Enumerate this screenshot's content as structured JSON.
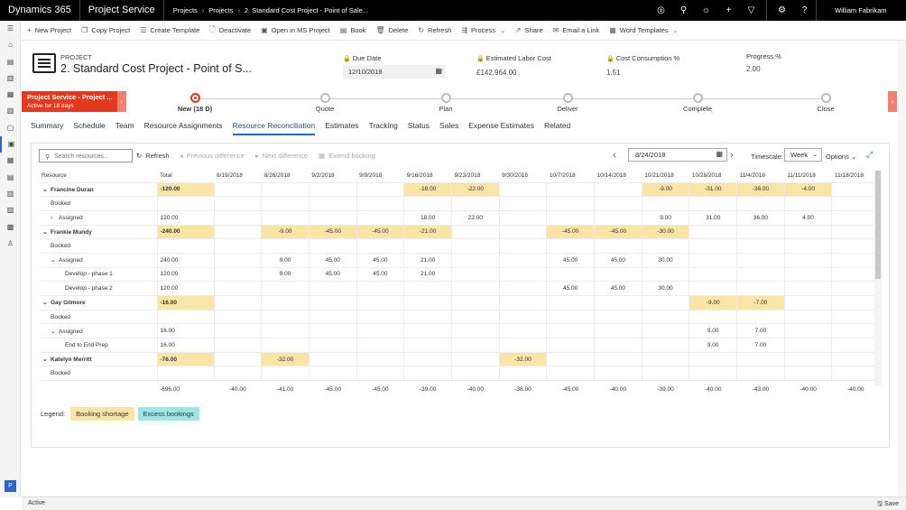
{
  "topbar": {
    "brand": "Dynamics 365",
    "app": "Project Service",
    "crumbs": [
      "Projects",
      "Projects",
      "2. Standard Cost Project - Point of Sale..."
    ],
    "user": "William Fabrikam",
    "icons": [
      "target-icon",
      "search-icon",
      "lightbulb-icon",
      "plus-icon",
      "filter-icon",
      "gear-icon",
      "help-icon"
    ]
  },
  "leftnav": {
    "items": [
      "menu-icon",
      "home-icon",
      "recent-icon",
      "pinned-icon",
      "projects-icon",
      "resources-icon",
      "documents-icon",
      "project-grid-icon",
      "calendar-icon",
      "schedule-icon",
      "list-icon",
      "contacts-icon",
      "settings-icon",
      "people-icon"
    ],
    "badge": "P"
  },
  "commands": [
    {
      "icon": "+",
      "label": "New Project",
      "chevron": false
    },
    {
      "icon": "❐",
      "label": "Copy Project",
      "chevron": false
    },
    {
      "icon": "☰",
      "label": "Create Template",
      "chevron": false
    },
    {
      "icon": "🗋",
      "label": "Deactivate",
      "chevron": false
    },
    {
      "icon": "▣",
      "label": "Open in MS Project",
      "chevron": false
    },
    {
      "icon": "▤",
      "label": "Book",
      "chevron": false
    },
    {
      "icon": "🗑",
      "label": "Delete",
      "chevron": false
    },
    {
      "icon": "↻",
      "label": "Refresh",
      "chevron": false
    },
    {
      "icon": "⇶",
      "label": "Process",
      "chevron": true
    },
    {
      "icon": "↗",
      "label": "Share",
      "chevron": false
    },
    {
      "icon": "✉",
      "label": "Email a Link",
      "chevron": false
    },
    {
      "icon": "▦",
      "label": "Word Templates",
      "chevron": true
    }
  ],
  "header": {
    "type": "PROJECT",
    "name": "2. Standard Cost Project - Point of S...",
    "due_date_label": "Due Date",
    "due_date": "12/10/2018",
    "labor_label": "Estimated Labor Cost",
    "labor": "£142,964.00",
    "cc_label": "Cost Consumption %",
    "cc": "1.51",
    "progress_label": "Progress %",
    "progress": "2.00"
  },
  "bpf": {
    "active_title": "Project Service - Project ...",
    "active_sub": "Active for 18 days",
    "stages": [
      {
        "label": "New  (18 D)",
        "current": true
      },
      {
        "label": "Quote",
        "current": false
      },
      {
        "label": "Plan",
        "current": false
      },
      {
        "label": "Deliver",
        "current": false
      },
      {
        "label": "Complete",
        "current": false
      },
      {
        "label": "Close",
        "current": false
      }
    ]
  },
  "tabs": [
    {
      "label": "Summary",
      "active": false
    },
    {
      "label": "Schedule",
      "active": false
    },
    {
      "label": "Team",
      "active": false
    },
    {
      "label": "Resource Assignments",
      "active": false
    },
    {
      "label": "Resource Reconciliation",
      "active": true
    },
    {
      "label": "Estimates",
      "active": false
    },
    {
      "label": "Tracking",
      "active": false
    },
    {
      "label": "Status",
      "active": false
    },
    {
      "label": "Sales",
      "active": false
    },
    {
      "label": "Expense Estimates",
      "active": false
    },
    {
      "label": "Related",
      "active": false
    }
  ],
  "toolbar": {
    "search_placeholder": "Search resources...",
    "refresh": "Refresh",
    "prev_diff": "Previous difference",
    "next_diff": "Next difference",
    "extend": "Extend booking",
    "date": "8/24/2018",
    "timescale_label": "Timescale:",
    "timescale": "Week",
    "options": "Options"
  },
  "grid": {
    "columns": [
      "Resource",
      "Total",
      "8/19/2018",
      "8/26/2018",
      "9/2/2018",
      "9/9/2018",
      "9/16/2018",
      "9/23/2018",
      "9/30/2018",
      "10/7/2018",
      "10/14/2018",
      "10/21/2018",
      "10/28/2018",
      "11/4/2018",
      "11/11/2018",
      "11/18/2018"
    ],
    "rows": [
      {
        "name": "Francine Duran",
        "level": 0,
        "caret": "v",
        "kind": "person",
        "total": "-120.00",
        "totalStyle": "short",
        "cells": [
          "",
          "",
          "",
          "",
          "-18.00",
          "-22.00",
          "",
          "",
          "",
          "-9.00",
          "-31.00",
          "-36.00",
          "-4.00",
          ""
        ],
        "styles": [
          "",
          "",
          "",
          "",
          "short",
          "short",
          "",
          "",
          "",
          "short",
          "short",
          "short",
          "short",
          ""
        ]
      },
      {
        "name": "Booked",
        "level": 1,
        "caret": "",
        "kind": "sub",
        "total": "",
        "totalStyle": "",
        "cells": [
          "",
          "",
          "",
          "",
          "",
          "",
          "",
          "",
          "",
          "",
          "",
          "",
          "",
          ""
        ],
        "styles": [
          "",
          "",
          "",
          "",
          "",
          "",
          "",
          "",
          "",
          "",
          "",
          "",
          "",
          ""
        ]
      },
      {
        "name": "Assigned",
        "level": 1,
        "caret": ">",
        "kind": "sub",
        "total": "120.00",
        "totalStyle": "",
        "cells": [
          "",
          "",
          "",
          "",
          "18.00",
          "22.00",
          "",
          "",
          "",
          "9.00",
          "31.00",
          "36.00",
          "4.00",
          ""
        ],
        "styles": [
          "",
          "",
          "",
          "",
          "",
          "",
          "",
          "",
          "",
          "",
          "",
          "",
          "",
          ""
        ]
      },
      {
        "name": "Frankie Mundy",
        "level": 0,
        "caret": "v",
        "kind": "person",
        "total": "-240.00",
        "totalStyle": "short",
        "cells": [
          "",
          "-9.00",
          "-45.00",
          "-45.00",
          "-21.00",
          "",
          "",
          "-45.00",
          "-45.00",
          "-30.00",
          "",
          "",
          "",
          ""
        ],
        "styles": [
          "",
          "short",
          "short",
          "short",
          "short",
          "",
          "",
          "short",
          "short",
          "short",
          "",
          "",
          "",
          ""
        ]
      },
      {
        "name": "Booked",
        "level": 1,
        "caret": "",
        "kind": "sub",
        "total": "",
        "totalStyle": "",
        "cells": [
          "",
          "",
          "",
          "",
          "",
          "",
          "",
          "",
          "",
          "",
          "",
          "",
          "",
          ""
        ],
        "styles": [
          "",
          "",
          "",
          "",
          "",
          "",
          "",
          "",
          "",
          "",
          "",
          "",
          "",
          ""
        ]
      },
      {
        "name": "Assigned",
        "level": 1,
        "caret": "v",
        "kind": "sub",
        "total": "240.00",
        "totalStyle": "",
        "cells": [
          "",
          "9.00",
          "45.00",
          "45.00",
          "21.00",
          "",
          "",
          "45.00",
          "45.00",
          "30.00",
          "",
          "",
          "",
          ""
        ],
        "styles": [
          "",
          "",
          "",
          "",
          "",
          "",
          "",
          "",
          "",
          "",
          "",
          "",
          "",
          ""
        ]
      },
      {
        "name": "Develop - phase 1",
        "level": 2,
        "caret": "",
        "kind": "task",
        "total": "120.00",
        "totalStyle": "",
        "cells": [
          "",
          "9.00",
          "45.00",
          "45.00",
          "21.00",
          "",
          "",
          "",
          "",
          "",
          "",
          "",
          "",
          ""
        ],
        "styles": [
          "",
          "",
          "",
          "",
          "",
          "",
          "",
          "",
          "",
          "",
          "",
          "",
          "",
          ""
        ]
      },
      {
        "name": "Develop - phase 2",
        "level": 2,
        "caret": "",
        "kind": "task",
        "total": "120.00",
        "totalStyle": "",
        "cells": [
          "",
          "",
          "",
          "",
          "",
          "",
          "",
          "45.00",
          "45.00",
          "30.00",
          "",
          "",
          "",
          ""
        ],
        "styles": [
          "",
          "",
          "",
          "",
          "",
          "",
          "",
          "",
          "",
          "",
          "",
          "",
          "",
          ""
        ]
      },
      {
        "name": "Gay Gilmore",
        "level": 0,
        "caret": "v",
        "kind": "person",
        "total": "-16.00",
        "totalStyle": "short",
        "cells": [
          "",
          "",
          "",
          "",
          "",
          "",
          "",
          "",
          "",
          "",
          "-9.00",
          "-7.00",
          "",
          ""
        ],
        "styles": [
          "",
          "",
          "",
          "",
          "",
          "",
          "",
          "",
          "",
          "",
          "short",
          "short",
          "",
          ""
        ]
      },
      {
        "name": "Booked",
        "level": 1,
        "caret": "",
        "kind": "sub",
        "total": "",
        "totalStyle": "",
        "cells": [
          "",
          "",
          "",
          "",
          "",
          "",
          "",
          "",
          "",
          "",
          "",
          "",
          "",
          ""
        ],
        "styles": [
          "",
          "",
          "",
          "",
          "",
          "",
          "",
          "",
          "",
          "",
          "",
          "",
          "",
          ""
        ]
      },
      {
        "name": "Assigned",
        "level": 1,
        "caret": "v",
        "kind": "sub",
        "total": "16.00",
        "totalStyle": "",
        "cells": [
          "",
          "",
          "",
          "",
          "",
          "",
          "",
          "",
          "",
          "",
          "9.00",
          "7.00",
          "",
          ""
        ],
        "styles": [
          "",
          "",
          "",
          "",
          "",
          "",
          "",
          "",
          "",
          "",
          "",
          "",
          "",
          ""
        ]
      },
      {
        "name": "End to End Prep",
        "level": 2,
        "caret": "",
        "kind": "task",
        "total": "16.00",
        "totalStyle": "",
        "cells": [
          "",
          "",
          "",
          "",
          "",
          "",
          "",
          "",
          "",
          "",
          "9.00",
          "7.00",
          "",
          ""
        ],
        "styles": [
          "",
          "",
          "",
          "",
          "",
          "",
          "",
          "",
          "",
          "",
          "",
          "",
          "",
          ""
        ]
      },
      {
        "name": "Katelyn Merritt",
        "level": 0,
        "caret": "v",
        "kind": "person",
        "total": "-76.00",
        "totalStyle": "short",
        "cells": [
          "",
          "-32.00",
          "",
          "",
          "",
          "",
          "-32.00",
          "",
          "",
          "",
          "",
          "",
          "",
          ""
        ],
        "styles": [
          "",
          "short",
          "",
          "",
          "",
          "",
          "short",
          "",
          "",
          "",
          "",
          "",
          "",
          ""
        ]
      },
      {
        "name": "Booked",
        "level": 1,
        "caret": "",
        "kind": "sub",
        "total": "",
        "totalStyle": "",
        "cells": [
          "",
          "",
          "",
          "",
          "",
          "",
          "",
          "",
          "",
          "",
          "",
          "",
          "",
          ""
        ],
        "styles": [
          "",
          "",
          "",
          "",
          "",
          "",
          "",
          "",
          "",
          "",
          "",
          "",
          "",
          ""
        ]
      }
    ],
    "footer": {
      "total": "-696.00",
      "cells": [
        "-40.00",
        "-41.00",
        "-45.00",
        "-45.00",
        "-39.00",
        "-40.00",
        "-38.00",
        "-45.00",
        "-40.00",
        "-39.00",
        "-40.00",
        "-43.00",
        "-40.00",
        "-40.00"
      ]
    }
  },
  "legend": {
    "label": "Legend:",
    "shortage": "Booking shortage",
    "excess": "Excess bookings"
  },
  "status": {
    "text": "Active",
    "save": "Save"
  },
  "colors": {
    "accent": "#2a62d1",
    "stage_active": "#e33a1f",
    "shortage": "#fae5a6",
    "excess": "#9ee6e6"
  }
}
